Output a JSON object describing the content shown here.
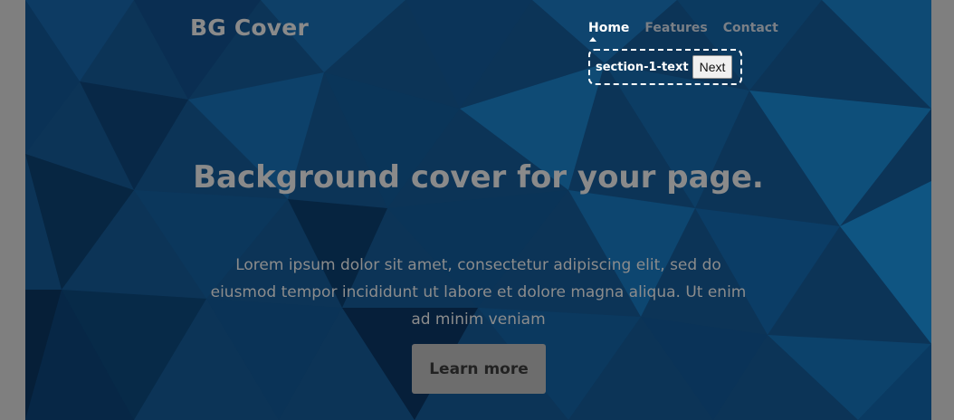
{
  "brand": {
    "title": "BG Cover"
  },
  "nav": {
    "items": [
      {
        "label": "Home",
        "active": true
      },
      {
        "label": "Features",
        "active": false
      },
      {
        "label": "Contact",
        "active": false
      }
    ]
  },
  "tour": {
    "text": "section-1-text",
    "next_label": "Next"
  },
  "hero": {
    "title": "Background cover for your page.",
    "text": "Lorem ipsum dolor sit amet, consectetur adipiscing elit, sed do eiusmod tempor incididunt ut labore et dolore magna aliqua. Ut enim ad minim veniam",
    "button_label": "Learn more"
  },
  "colors": {
    "background": "#0b3154",
    "overlay": "#808080",
    "nav_active": "#ffffff",
    "nav_inactive": "#7a7f86"
  }
}
